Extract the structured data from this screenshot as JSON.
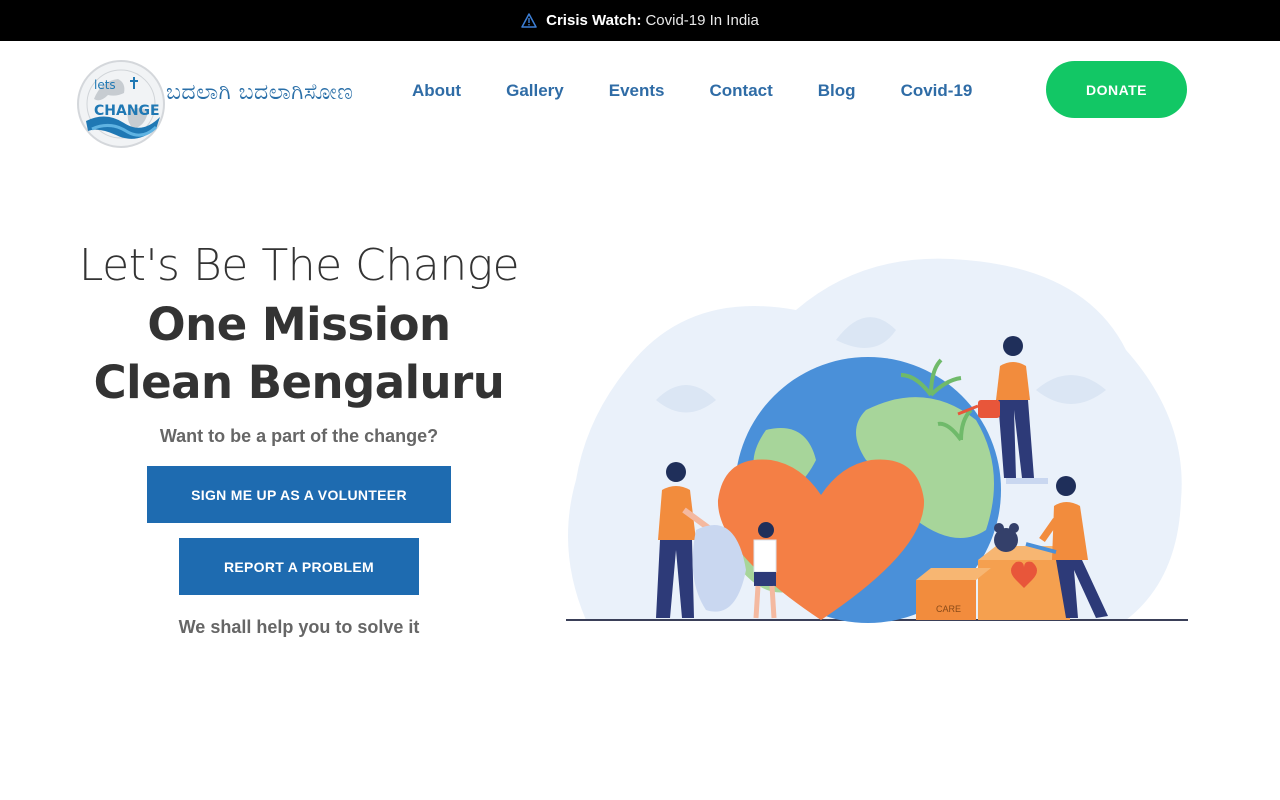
{
  "topbar": {
    "label": "Crisis Watch:",
    "link": "Covid-19 In India",
    "icon": "warning-icon"
  },
  "header": {
    "logo_text": "ಬದಲಾಗಿ ಬದಲಾಗಿಸೋಣ",
    "logo_icon": "globe-logo",
    "nav": [
      "About",
      "Gallery",
      "Events",
      "Contact",
      "Blog",
      "Covid-19"
    ],
    "donate_label": "DONATE"
  },
  "hero": {
    "headline_light": "Let's Be The Change",
    "headline_bold_1": "One Mission",
    "headline_bold_2": "Clean Bengaluru",
    "subtitle": "Want to be a part of the change?",
    "volunteer_button": "SIGN ME UP AS A VOLUNTEER",
    "report_button": "REPORT A PROBLEM",
    "help_text": "We shall help you to solve it",
    "illustration_label": "CARE"
  },
  "colors": {
    "accent": "#1e6bb0",
    "donate": "#12c765",
    "nav": "#2f6ca6"
  }
}
